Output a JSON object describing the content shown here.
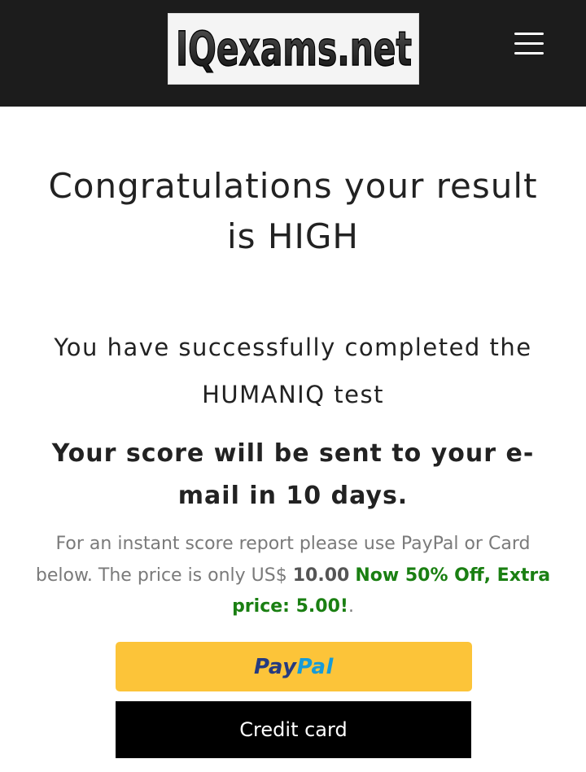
{
  "header": {
    "logo_text": "IQexams.net"
  },
  "main": {
    "title": "Congratulations your result is HIGH",
    "completed_text": "You have successfully completed the HUMANIQ test",
    "score_note": "Your score will be sent to your e-mail in 10 days.",
    "instant_prefix": "For an instant score report please use PayPal or Card below. The price is only US$ ",
    "price": "10.00",
    "offer": "Now 50% Off, Extra price: 5.00!",
    "instant_suffix": "."
  },
  "payment": {
    "paypal_pay": "Pay",
    "paypal_pal": "Pal",
    "card_label": "Credit card"
  },
  "colors": {
    "header_bg": "#1c1c1c",
    "paypal_button": "#fcc439",
    "offer_green": "#1a7f12",
    "card_button": "#000000"
  }
}
